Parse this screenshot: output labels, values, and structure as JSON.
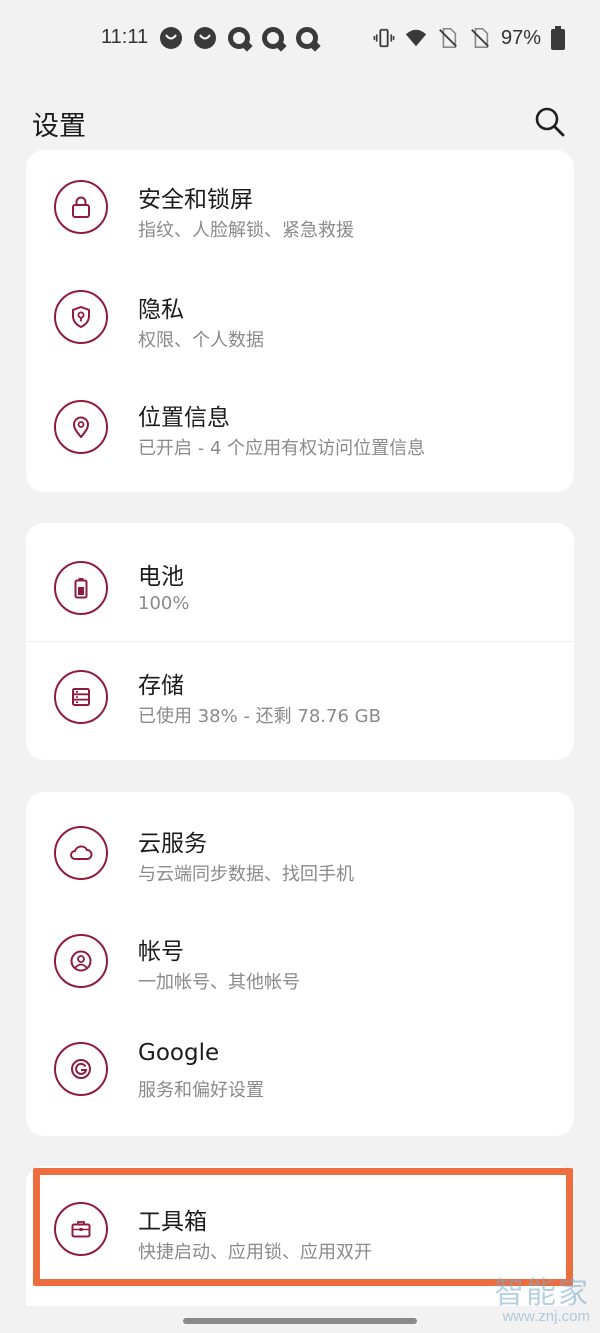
{
  "status_bar": {
    "time": "11:11",
    "battery_percent": "97%",
    "notification_icons": [
      "notification-circle-icon",
      "notification-circle-icon",
      "notification-q-icon",
      "notification-q-icon",
      "notification-q-icon"
    ],
    "system_icons": [
      "vibrate-icon",
      "wifi-icon",
      "no-sim-icon",
      "no-sim-icon",
      "battery-icon"
    ]
  },
  "header": {
    "title": "设置",
    "search_icon": "search-icon"
  },
  "groups": [
    {
      "items": [
        {
          "icon": "lock-icon",
          "title": "安全和锁屏",
          "subtitle": "指纹、人脸解锁、紧急救援"
        },
        {
          "icon": "privacy-shield-icon",
          "title": "隐私",
          "subtitle": "权限、个人数据"
        },
        {
          "icon": "location-pin-icon",
          "title": "位置信息",
          "subtitle": "已开启 - 4 个应用有权访问位置信息"
        }
      ]
    },
    {
      "items": [
        {
          "icon": "battery-icon",
          "title": "电池",
          "subtitle": "100%"
        },
        {
          "icon": "storage-icon",
          "title": "存储",
          "subtitle": "已使用 38% - 还剩 78.76 GB"
        }
      ]
    },
    {
      "items": [
        {
          "icon": "cloud-icon",
          "title": "云服务",
          "subtitle": "与云端同步数据、找回手机"
        },
        {
          "icon": "account-icon",
          "title": "帐号",
          "subtitle": "一加帐号、其他帐号"
        },
        {
          "icon": "google-icon",
          "title": "Google",
          "subtitle": "服务和偏好设置"
        }
      ]
    },
    {
      "items": [
        {
          "icon": "toolbox-icon",
          "title": "工具箱",
          "subtitle": "快捷启动、应用锁、应用双开"
        }
      ]
    }
  ],
  "watermark": {
    "text": "智能家",
    "url": "www.znj.com"
  },
  "colors": {
    "accent": "#8e1c3d",
    "highlight": "#ee6d3f",
    "background": "#f2f2f2",
    "card": "#ffffff"
  }
}
